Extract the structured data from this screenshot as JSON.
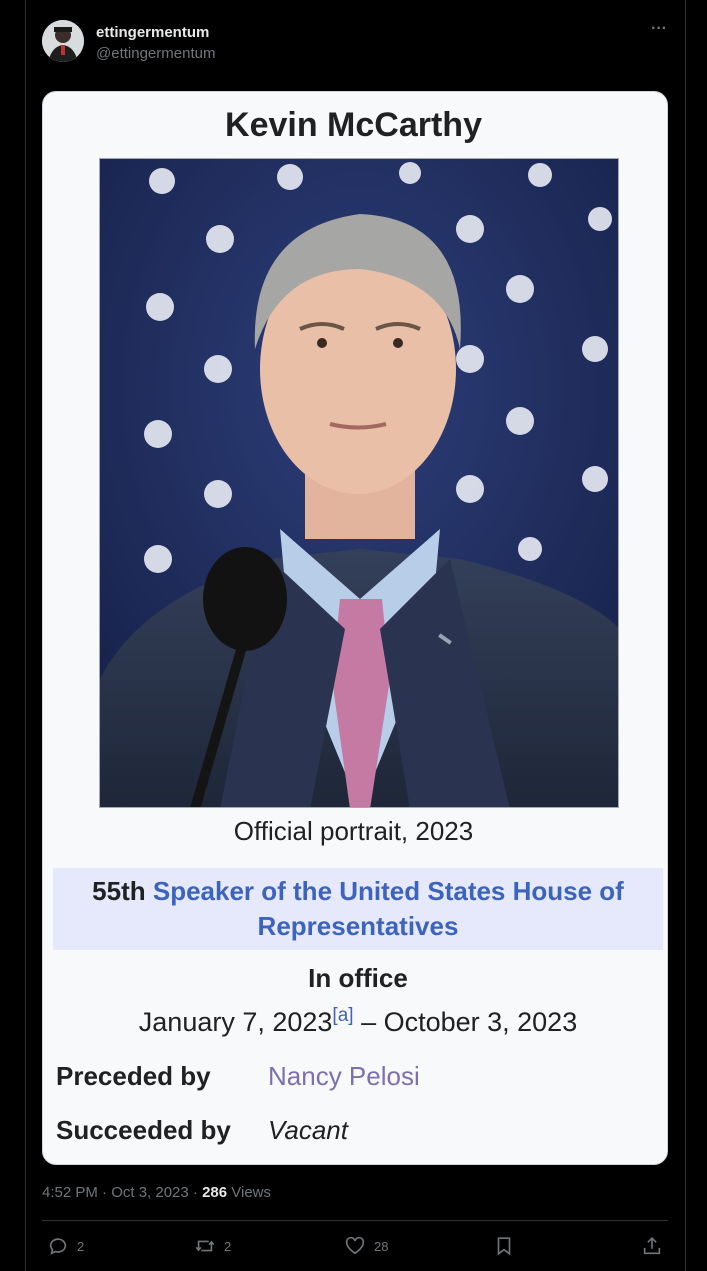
{
  "post": {
    "display_name": "ettingermentum",
    "handle": "@ettingermentum",
    "more_icon": "···"
  },
  "infobox": {
    "title": "Kevin McCarthy",
    "caption": "Official portrait, 2023",
    "office_ordinal": "55th",
    "office_link": "Speaker of the United States House of Representatives",
    "in_office_label": "In office",
    "term_start": "January 7, 2023",
    "term_footnote": "[a]",
    "term_end": "– October 3, 2023",
    "preceded_label": "Preceded by",
    "preceded_value": "Nancy Pelosi",
    "succeeded_label": "Succeeded by",
    "succeeded_value": "Vacant"
  },
  "meta": {
    "time_date": "4:52 PM · Oct 3, 2023 · ",
    "views_count": "286",
    "views_label": " Views"
  },
  "actions": {
    "replies": "2",
    "reposts": "2",
    "likes": "28"
  },
  "colors": {
    "background": "#000000",
    "link_blue": "#3d64bd",
    "visited_purple": "#7f6fb0",
    "office_band": "#e6e8fb"
  }
}
